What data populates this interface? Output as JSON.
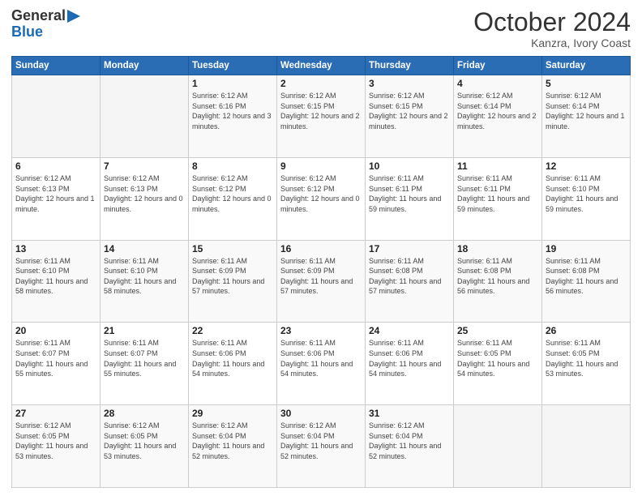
{
  "header": {
    "logo_line1": "General",
    "logo_line2": "Blue",
    "month": "October 2024",
    "location": "Kanzra, Ivory Coast"
  },
  "weekdays": [
    "Sunday",
    "Monday",
    "Tuesday",
    "Wednesday",
    "Thursday",
    "Friday",
    "Saturday"
  ],
  "weeks": [
    [
      {
        "day": "",
        "sunrise": "",
        "sunset": "",
        "daylight": ""
      },
      {
        "day": "",
        "sunrise": "",
        "sunset": "",
        "daylight": ""
      },
      {
        "day": "1",
        "sunrise": "Sunrise: 6:12 AM",
        "sunset": "Sunset: 6:16 PM",
        "daylight": "Daylight: 12 hours and 3 minutes."
      },
      {
        "day": "2",
        "sunrise": "Sunrise: 6:12 AM",
        "sunset": "Sunset: 6:15 PM",
        "daylight": "Daylight: 12 hours and 2 minutes."
      },
      {
        "day": "3",
        "sunrise": "Sunrise: 6:12 AM",
        "sunset": "Sunset: 6:15 PM",
        "daylight": "Daylight: 12 hours and 2 minutes."
      },
      {
        "day": "4",
        "sunrise": "Sunrise: 6:12 AM",
        "sunset": "Sunset: 6:14 PM",
        "daylight": "Daylight: 12 hours and 2 minutes."
      },
      {
        "day": "5",
        "sunrise": "Sunrise: 6:12 AM",
        "sunset": "Sunset: 6:14 PM",
        "daylight": "Daylight: 12 hours and 1 minute."
      }
    ],
    [
      {
        "day": "6",
        "sunrise": "Sunrise: 6:12 AM",
        "sunset": "Sunset: 6:13 PM",
        "daylight": "Daylight: 12 hours and 1 minute."
      },
      {
        "day": "7",
        "sunrise": "Sunrise: 6:12 AM",
        "sunset": "Sunset: 6:13 PM",
        "daylight": "Daylight: 12 hours and 0 minutes."
      },
      {
        "day": "8",
        "sunrise": "Sunrise: 6:12 AM",
        "sunset": "Sunset: 6:12 PM",
        "daylight": "Daylight: 12 hours and 0 minutes."
      },
      {
        "day": "9",
        "sunrise": "Sunrise: 6:12 AM",
        "sunset": "Sunset: 6:12 PM",
        "daylight": "Daylight: 12 hours and 0 minutes."
      },
      {
        "day": "10",
        "sunrise": "Sunrise: 6:11 AM",
        "sunset": "Sunset: 6:11 PM",
        "daylight": "Daylight: 11 hours and 59 minutes."
      },
      {
        "day": "11",
        "sunrise": "Sunrise: 6:11 AM",
        "sunset": "Sunset: 6:11 PM",
        "daylight": "Daylight: 11 hours and 59 minutes."
      },
      {
        "day": "12",
        "sunrise": "Sunrise: 6:11 AM",
        "sunset": "Sunset: 6:10 PM",
        "daylight": "Daylight: 11 hours and 59 minutes."
      }
    ],
    [
      {
        "day": "13",
        "sunrise": "Sunrise: 6:11 AM",
        "sunset": "Sunset: 6:10 PM",
        "daylight": "Daylight: 11 hours and 58 minutes."
      },
      {
        "day": "14",
        "sunrise": "Sunrise: 6:11 AM",
        "sunset": "Sunset: 6:10 PM",
        "daylight": "Daylight: 11 hours and 58 minutes."
      },
      {
        "day": "15",
        "sunrise": "Sunrise: 6:11 AM",
        "sunset": "Sunset: 6:09 PM",
        "daylight": "Daylight: 11 hours and 57 minutes."
      },
      {
        "day": "16",
        "sunrise": "Sunrise: 6:11 AM",
        "sunset": "Sunset: 6:09 PM",
        "daylight": "Daylight: 11 hours and 57 minutes."
      },
      {
        "day": "17",
        "sunrise": "Sunrise: 6:11 AM",
        "sunset": "Sunset: 6:08 PM",
        "daylight": "Daylight: 11 hours and 57 minutes."
      },
      {
        "day": "18",
        "sunrise": "Sunrise: 6:11 AM",
        "sunset": "Sunset: 6:08 PM",
        "daylight": "Daylight: 11 hours and 56 minutes."
      },
      {
        "day": "19",
        "sunrise": "Sunrise: 6:11 AM",
        "sunset": "Sunset: 6:08 PM",
        "daylight": "Daylight: 11 hours and 56 minutes."
      }
    ],
    [
      {
        "day": "20",
        "sunrise": "Sunrise: 6:11 AM",
        "sunset": "Sunset: 6:07 PM",
        "daylight": "Daylight: 11 hours and 55 minutes."
      },
      {
        "day": "21",
        "sunrise": "Sunrise: 6:11 AM",
        "sunset": "Sunset: 6:07 PM",
        "daylight": "Daylight: 11 hours and 55 minutes."
      },
      {
        "day": "22",
        "sunrise": "Sunrise: 6:11 AM",
        "sunset": "Sunset: 6:06 PM",
        "daylight": "Daylight: 11 hours and 54 minutes."
      },
      {
        "day": "23",
        "sunrise": "Sunrise: 6:11 AM",
        "sunset": "Sunset: 6:06 PM",
        "daylight": "Daylight: 11 hours and 54 minutes."
      },
      {
        "day": "24",
        "sunrise": "Sunrise: 6:11 AM",
        "sunset": "Sunset: 6:06 PM",
        "daylight": "Daylight: 11 hours and 54 minutes."
      },
      {
        "day": "25",
        "sunrise": "Sunrise: 6:11 AM",
        "sunset": "Sunset: 6:05 PM",
        "daylight": "Daylight: 11 hours and 54 minutes."
      },
      {
        "day": "26",
        "sunrise": "Sunrise: 6:11 AM",
        "sunset": "Sunset: 6:05 PM",
        "daylight": "Daylight: 11 hours and 53 minutes."
      }
    ],
    [
      {
        "day": "27",
        "sunrise": "Sunrise: 6:12 AM",
        "sunset": "Sunset: 6:05 PM",
        "daylight": "Daylight: 11 hours and 53 minutes."
      },
      {
        "day": "28",
        "sunrise": "Sunrise: 6:12 AM",
        "sunset": "Sunset: 6:05 PM",
        "daylight": "Daylight: 11 hours and 53 minutes."
      },
      {
        "day": "29",
        "sunrise": "Sunrise: 6:12 AM",
        "sunset": "Sunset: 6:04 PM",
        "daylight": "Daylight: 11 hours and 52 minutes."
      },
      {
        "day": "30",
        "sunrise": "Sunrise: 6:12 AM",
        "sunset": "Sunset: 6:04 PM",
        "daylight": "Daylight: 11 hours and 52 minutes."
      },
      {
        "day": "31",
        "sunrise": "Sunrise: 6:12 AM",
        "sunset": "Sunset: 6:04 PM",
        "daylight": "Daylight: 11 hours and 52 minutes."
      },
      {
        "day": "",
        "sunrise": "",
        "sunset": "",
        "daylight": ""
      },
      {
        "day": "",
        "sunrise": "",
        "sunset": "",
        "daylight": ""
      }
    ]
  ]
}
